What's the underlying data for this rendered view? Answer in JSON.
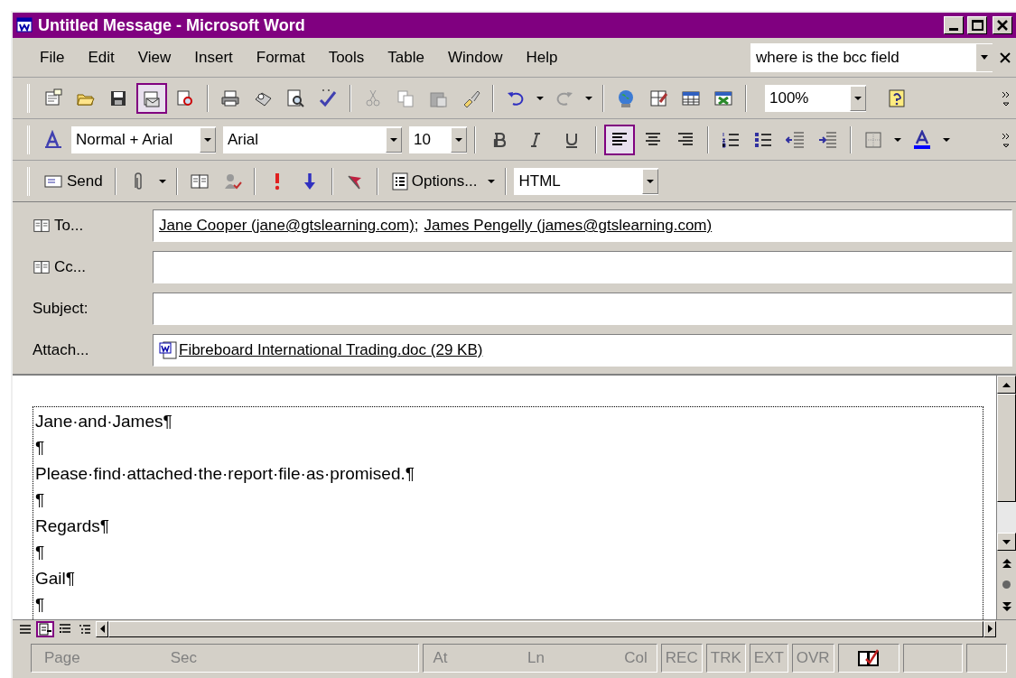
{
  "window": {
    "title": "Untitled Message - Microsoft Word"
  },
  "menu": [
    {
      "label": "File"
    },
    {
      "label": "Edit"
    },
    {
      "label": "View"
    },
    {
      "label": "Insert"
    },
    {
      "label": "Format"
    },
    {
      "label": "Tools"
    },
    {
      "label": "Table"
    },
    {
      "label": "Window"
    },
    {
      "label": "Help"
    }
  ],
  "help_box": {
    "value": "where is the bcc field"
  },
  "standard_toolbar": {
    "email_pressed": true,
    "zoom": "100%"
  },
  "formatting_toolbar": {
    "style": "Normal + Arial",
    "font": "Arial",
    "size": "10",
    "alignment_buttons": [
      {
        "kind": "left",
        "selected": true
      },
      {
        "kind": "center",
        "selected": false
      },
      {
        "kind": "right",
        "selected": false
      }
    ]
  },
  "email_toolbar": {
    "send": {
      "label": "Send"
    },
    "options": {
      "label": "Options..."
    },
    "format": "HTML"
  },
  "fields": [
    {
      "label": "To...",
      "kind": "address",
      "recipients": [
        "Jane Cooper (jane@gtslearning.com)",
        "James Pengelly (james@gtslearning.com)"
      ],
      "separator": ";"
    },
    {
      "label": "Cc...",
      "kind": "address"
    },
    {
      "label": "Subject:",
      "kind": "text"
    },
    {
      "label": "Attach...",
      "kind": "attachment",
      "file": "Fibreboard International Trading.doc (29 KB)"
    }
  ],
  "body": {
    "lines": [
      "Jane·and·James¶",
      "¶",
      "Please·find·attached·the·report·file·as·promised.¶",
      "¶",
      "Regards¶",
      "¶",
      "Gail¶",
      "¶"
    ]
  },
  "views": [
    {
      "kind": "normal",
      "selected": false
    },
    {
      "kind": "web",
      "selected": true
    },
    {
      "kind": "print",
      "selected": false
    },
    {
      "kind": "outline",
      "selected": false
    }
  ],
  "status_bar": {
    "fields": [
      {
        "label": "Page"
      },
      {
        "label": "Sec"
      },
      {
        "label": "At"
      },
      {
        "label": "Ln"
      },
      {
        "label": "Col"
      }
    ],
    "modes": [
      {
        "label": "REC",
        "active": false
      },
      {
        "label": "TRK",
        "active": false
      },
      {
        "label": "EXT",
        "active": false
      },
      {
        "label": "OVR",
        "active": false
      }
    ]
  }
}
